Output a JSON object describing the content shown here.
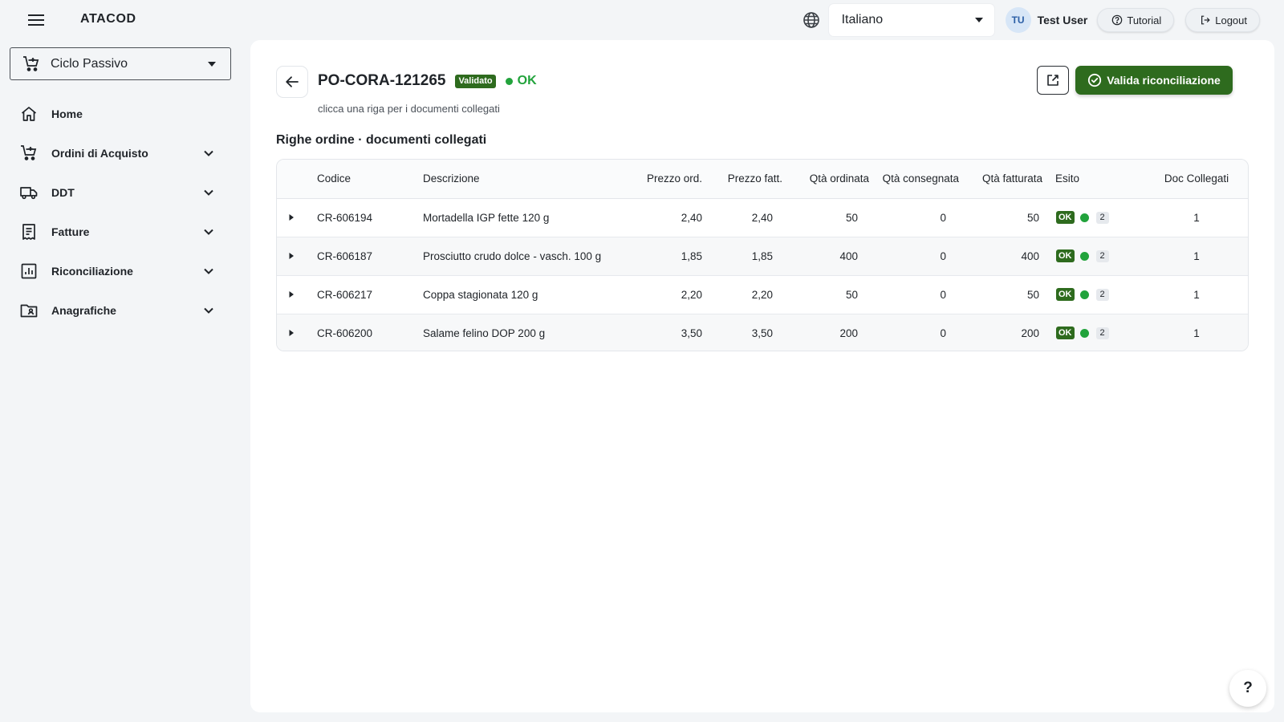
{
  "app": {
    "brand": "ATACOD"
  },
  "header": {
    "language": {
      "selected": "Italiano"
    },
    "user": {
      "initials": "TU",
      "name": "Test User"
    },
    "tutorial_label": "Tutorial",
    "logout_label": "Logout"
  },
  "sidebar": {
    "module": {
      "label": "Ciclo Passivo"
    },
    "items": [
      {
        "label": "Home",
        "icon": "home-icon",
        "expandable": false
      },
      {
        "label": "Ordini di Acquisto",
        "icon": "cart-icon",
        "expandable": true
      },
      {
        "label": "DDT",
        "icon": "truck-icon",
        "expandable": true
      },
      {
        "label": "Fatture",
        "icon": "invoice-icon",
        "expandable": true
      },
      {
        "label": "Riconciliazione",
        "icon": "report-icon",
        "expandable": true
      },
      {
        "label": "Anagrafiche",
        "icon": "folder-person-icon",
        "expandable": true
      }
    ]
  },
  "main": {
    "po_code": "PO-CORA-121265",
    "badge": "Validato",
    "status": "OK",
    "subtitle": "clicca una riga per i documenti collegati",
    "validate_label": "Valida riconciliazione",
    "section_title": "Righe ordine · documenti collegati",
    "table": {
      "columns": [
        "Codice",
        "Descrizione",
        "Prezzo ord.",
        "Prezzo fatt.",
        "Qtà ordinata",
        "Qtà consegnata",
        "Qtà fatturata",
        "Esito",
        "Doc Collegati"
      ],
      "rows": [
        {
          "codice": "CR-606194",
          "descrizione": "Mortadella IGP fette 120 g",
          "prezzo_ord": "2,40",
          "prezzo_fatt": "2,40",
          "qta_ordinata": "50",
          "qta_consegnata": "0",
          "qta_fatturata": "50",
          "esito": "OK",
          "esito_count": "2",
          "doc_collegati": "1"
        },
        {
          "codice": "CR-606187",
          "descrizione": "Prosciutto crudo dolce - vasch. 100 g",
          "prezzo_ord": "1,85",
          "prezzo_fatt": "1,85",
          "qta_ordinata": "400",
          "qta_consegnata": "0",
          "qta_fatturata": "400",
          "esito": "OK",
          "esito_count": "2",
          "doc_collegati": "1"
        },
        {
          "codice": "CR-606217",
          "descrizione": "Coppa stagionata 120 g",
          "prezzo_ord": "2,20",
          "prezzo_fatt": "2,20",
          "qta_ordinata": "50",
          "qta_consegnata": "0",
          "qta_fatturata": "50",
          "esito": "OK",
          "esito_count": "2",
          "doc_collegati": "1"
        },
        {
          "codice": "CR-606200",
          "descrizione": "Salame felino DOP 200 g",
          "prezzo_ord": "3,50",
          "prezzo_fatt": "3,50",
          "qta_ordinata": "200",
          "qta_consegnata": "0",
          "qta_fatturata": "200",
          "esito": "OK",
          "esito_count": "2",
          "doc_collegati": "1"
        }
      ]
    }
  },
  "help_label": "?",
  "colors": {
    "accent_green": "#2e6b1e",
    "status_green": "#22a33c",
    "page_bg": "#f3f5f7"
  }
}
